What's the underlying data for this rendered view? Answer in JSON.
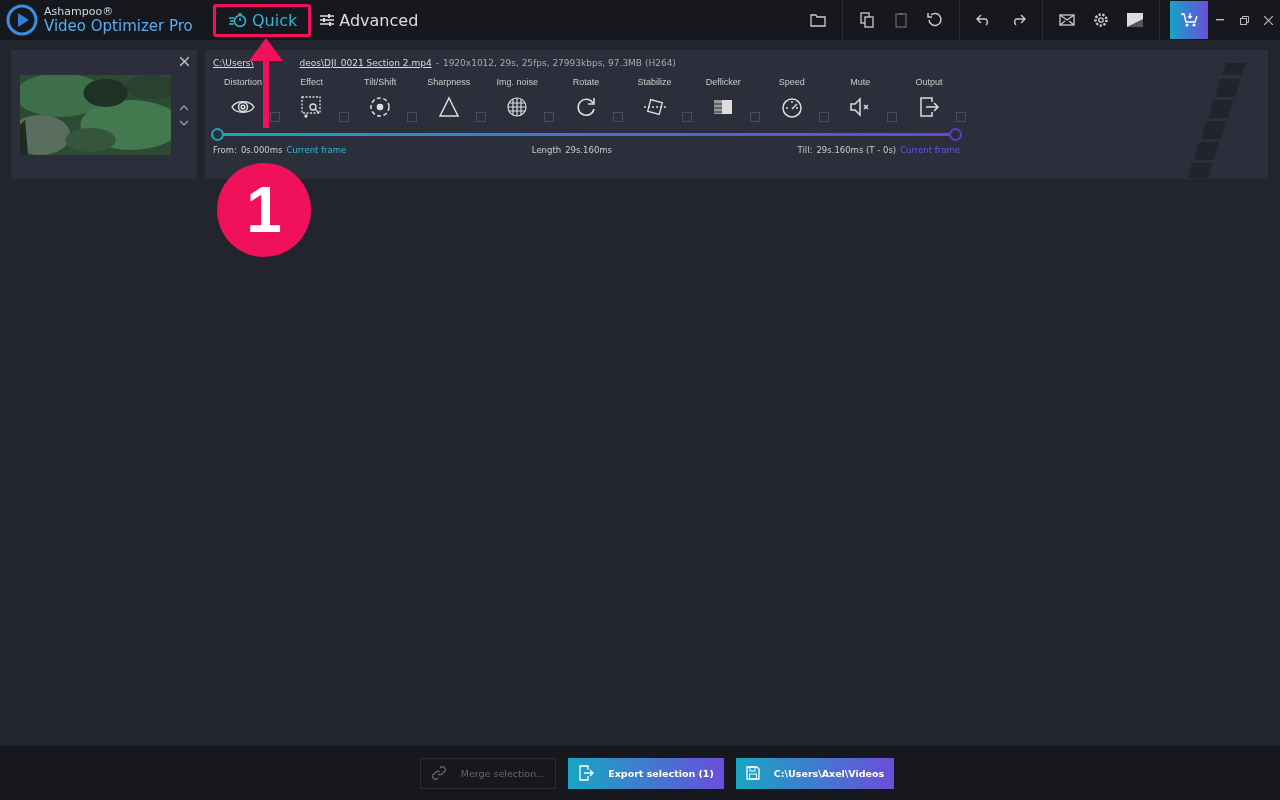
{
  "app": {
    "brand": "Ashampoo®",
    "title": "Video Optimizer Pro"
  },
  "modes": [
    {
      "label": "Quick",
      "selected": true
    },
    {
      "label": "Advanced",
      "selected": false
    }
  ],
  "clip": {
    "path_start": "C:\\Users\\",
    "path_end": "deos\\DJI_0021 Section 2.mp4",
    "separator": "-",
    "info": "1920x1012, 29s, 25fps, 27993kbps, 97.3MB (H264)",
    "tools": [
      {
        "label": "Distortion",
        "checked": false
      },
      {
        "label": "Effect",
        "checked": false
      },
      {
        "label": "Tilt/Shift",
        "checked": false
      },
      {
        "label": "Sharpness",
        "checked": false
      },
      {
        "label": "Img. noise",
        "checked": false
      },
      {
        "label": "Rotate",
        "checked": false
      },
      {
        "label": "Stabilize",
        "checked": false
      },
      {
        "label": "Deflicker",
        "checked": false
      },
      {
        "label": "Speed",
        "checked": false
      },
      {
        "label": "Mute",
        "checked": false
      },
      {
        "label": "Output",
        "checked": false
      }
    ],
    "range_start": {
      "level": 0
    },
    "range_end": {
      "level": 1
    },
    "from_label": "From:",
    "from_value": "0s.000ms",
    "from_link": "Current frame",
    "length_label": "Length",
    "length_value": "29s.160ms",
    "till_label": "Till:",
    "till_value": "29s.160ms (T - 0s)",
    "till_link": "Current frame"
  },
  "footer": {
    "merge": {
      "label": "Merge selection...",
      "disabled": true
    },
    "export": "Export selection (1)",
    "folder": "C:\\Users\\Axel\\Videos"
  },
  "annotation": {
    "label": "1"
  }
}
